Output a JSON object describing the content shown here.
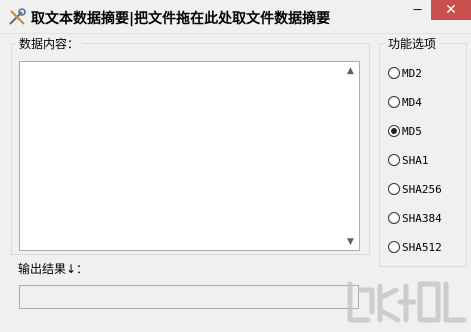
{
  "window": {
    "title": "取文本数据摘要|把文件拖在此处取文件数据摘要",
    "minimize_glyph": "─",
    "close_glyph": "✕"
  },
  "input_group": {
    "label": "数据内容：",
    "value": ""
  },
  "output": {
    "label": "输出结果↓：",
    "value": ""
  },
  "options": {
    "label": "功能选项",
    "items": [
      {
        "label": "MD2",
        "checked": false
      },
      {
        "label": "MD4",
        "checked": false
      },
      {
        "label": "MD5",
        "checked": true
      },
      {
        "label": "SHA1",
        "checked": false
      },
      {
        "label": "SHA256",
        "checked": false
      },
      {
        "label": "SHA384",
        "checked": false
      },
      {
        "label": "SHA512",
        "checked": false
      }
    ]
  },
  "scrollbar": {
    "up_glyph": "▲",
    "down_glyph": "▼"
  },
  "colors": {
    "close_button": "#c7504c",
    "window_bg": "#f0f0f0"
  }
}
